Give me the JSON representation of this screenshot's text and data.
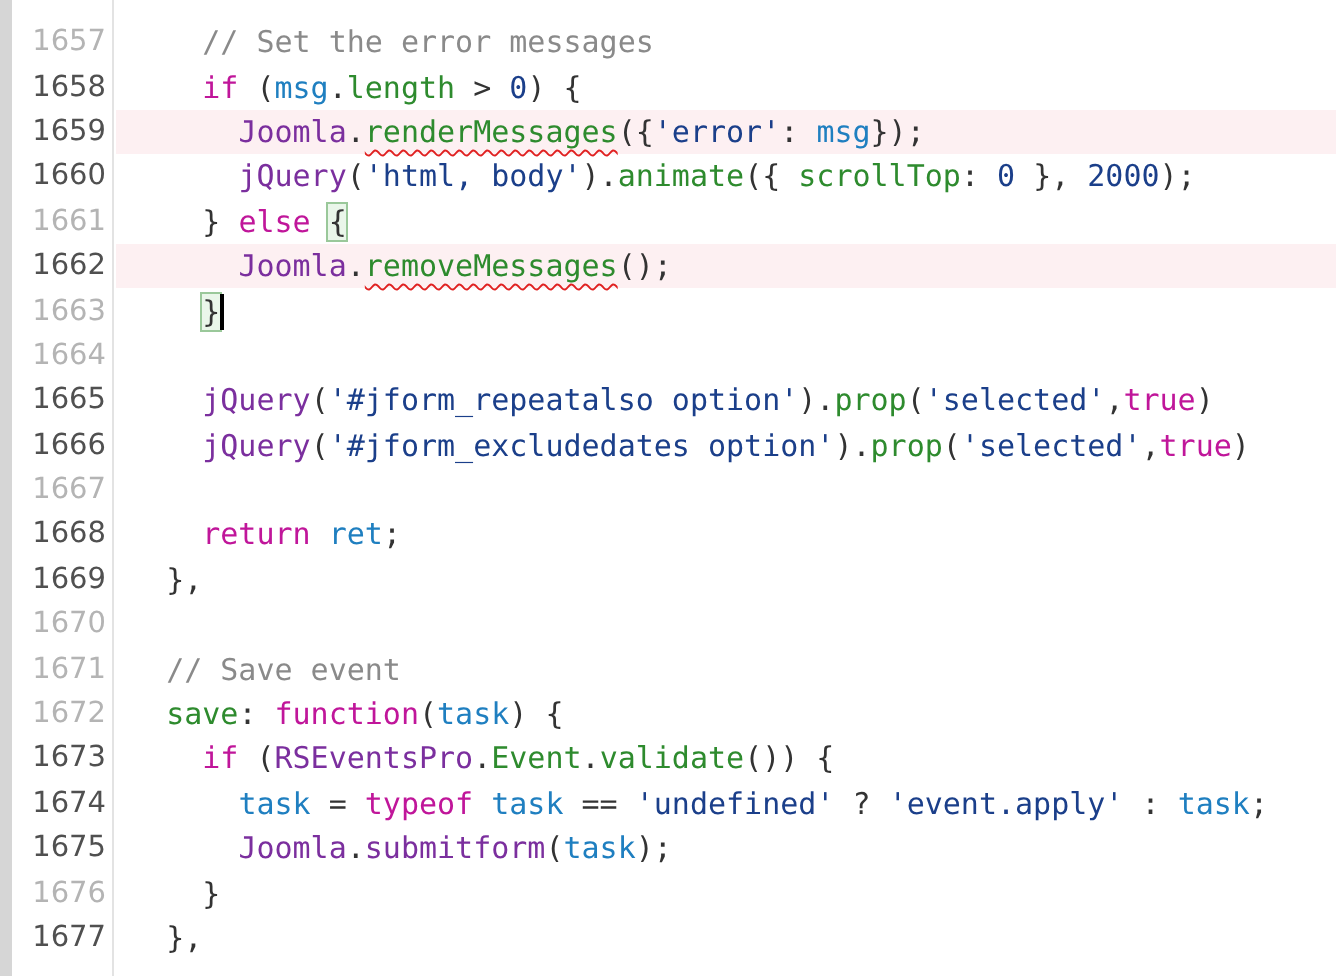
{
  "editor": {
    "lines": [
      {
        "number": "1657",
        "dimmed": true,
        "highlighted": false,
        "cursor": false,
        "tokens": [
          {
            "text": "    // Set the error messages",
            "kind": "comment"
          }
        ]
      },
      {
        "number": "1658",
        "dimmed": false,
        "highlighted": false,
        "cursor": false,
        "tokens": [
          {
            "text": "    if",
            "kind": "keyword"
          },
          {
            "text": " (",
            "kind": "punct"
          },
          {
            "text": "msg",
            "kind": "variable"
          },
          {
            "text": ".",
            "kind": "punct"
          },
          {
            "text": "length",
            "kind": "property"
          },
          {
            "text": " > ",
            "kind": "punct"
          },
          {
            "text": "0",
            "kind": "number"
          },
          {
            "text": ") {",
            "kind": "punct"
          }
        ]
      },
      {
        "number": "1659",
        "dimmed": false,
        "highlighted": true,
        "cursor": false,
        "tokens": [
          {
            "text": "      Joomla",
            "kind": "object"
          },
          {
            "text": ".",
            "kind": "punct"
          },
          {
            "text": "renderMessages",
            "kind": "property",
            "error": true
          },
          {
            "text": "({",
            "kind": "punct"
          },
          {
            "text": "'error'",
            "kind": "string"
          },
          {
            "text": ": ",
            "kind": "punct"
          },
          {
            "text": "msg",
            "kind": "variable"
          },
          {
            "text": "});",
            "kind": "punct"
          }
        ]
      },
      {
        "number": "1660",
        "dimmed": false,
        "highlighted": false,
        "cursor": false,
        "tokens": [
          {
            "text": "      jQuery",
            "kind": "object"
          },
          {
            "text": "(",
            "kind": "punct"
          },
          {
            "text": "'html, body'",
            "kind": "string"
          },
          {
            "text": ").",
            "kind": "punct"
          },
          {
            "text": "animate",
            "kind": "property"
          },
          {
            "text": "({ ",
            "kind": "punct"
          },
          {
            "text": "scrollTop",
            "kind": "property"
          },
          {
            "text": ": ",
            "kind": "punct"
          },
          {
            "text": "0",
            "kind": "number"
          },
          {
            "text": " }, ",
            "kind": "punct"
          },
          {
            "text": "2000",
            "kind": "number"
          },
          {
            "text": ");",
            "kind": "punct"
          }
        ]
      },
      {
        "number": "1661",
        "dimmed": true,
        "highlighted": false,
        "cursor": false,
        "tokens": [
          {
            "text": "    } ",
            "kind": "punct"
          },
          {
            "text": "else ",
            "kind": "keyword"
          },
          {
            "text": "{",
            "kind": "punct",
            "matched": true
          }
        ]
      },
      {
        "number": "1662",
        "dimmed": false,
        "highlighted": true,
        "cursor": false,
        "tokens": [
          {
            "text": "      Joomla",
            "kind": "object"
          },
          {
            "text": ".",
            "kind": "punct"
          },
          {
            "text": "removeMessages",
            "kind": "property",
            "error": true
          },
          {
            "text": "();",
            "kind": "punct"
          }
        ]
      },
      {
        "number": "1663",
        "dimmed": true,
        "highlighted": false,
        "cursor": true,
        "tokens": [
          {
            "text": "    }",
            "kind": "punct",
            "matched": true
          }
        ]
      },
      {
        "number": "1664",
        "dimmed": true,
        "highlighted": false,
        "cursor": false
      },
      {
        "number": "1665",
        "dimmed": false,
        "highlighted": false,
        "cursor": false,
        "tokens": [
          {
            "text": "    jQuery",
            "kind": "object"
          },
          {
            "text": "(",
            "kind": "punct"
          },
          {
            "text": "'#jform_repeatalso option'",
            "kind": "string"
          },
          {
            "text": ").",
            "kind": "punct"
          },
          {
            "text": "prop",
            "kind": "property"
          },
          {
            "text": "(",
            "kind": "punct"
          },
          {
            "text": "'selected'",
            "kind": "string"
          },
          {
            "text": ",",
            "kind": "punct"
          },
          {
            "text": "true",
            "kind": "keyword"
          },
          {
            "text": ")",
            "kind": "punct"
          }
        ]
      },
      {
        "number": "1666",
        "dimmed": false,
        "highlighted": false,
        "cursor": false,
        "tokens": [
          {
            "text": "    jQuery",
            "kind": "object"
          },
          {
            "text": "(",
            "kind": "punct"
          },
          {
            "text": "'#jform_excludedates option'",
            "kind": "string"
          },
          {
            "text": ").",
            "kind": "punct"
          },
          {
            "text": "prop",
            "kind": "property"
          },
          {
            "text": "(",
            "kind": "punct"
          },
          {
            "text": "'selected'",
            "kind": "string"
          },
          {
            "text": ",",
            "kind": "punct"
          },
          {
            "text": "true",
            "kind": "keyword"
          },
          {
            "text": ")",
            "kind": "punct"
          }
        ]
      },
      {
        "number": "1667",
        "dimmed": true,
        "highlighted": false,
        "cursor": false
      },
      {
        "number": "1668",
        "dimmed": false,
        "highlighted": false,
        "cursor": false,
        "tokens": [
          {
            "text": "    return ",
            "kind": "keyword"
          },
          {
            "text": "ret",
            "kind": "variable"
          },
          {
            "text": ";",
            "kind": "punct"
          }
        ]
      },
      {
        "number": "1669",
        "dimmed": false,
        "highlighted": false,
        "cursor": false,
        "tokens": [
          {
            "text": "  },",
            "kind": "punct"
          }
        ]
      },
      {
        "number": "1670",
        "dimmed": true,
        "highlighted": false,
        "cursor": false
      },
      {
        "number": "1671",
        "dimmed": true,
        "highlighted": false,
        "cursor": false,
        "tokens": [
          {
            "text": "  // Save event",
            "kind": "comment"
          }
        ]
      },
      {
        "number": "1672",
        "dimmed": true,
        "highlighted": false,
        "cursor": false,
        "tokens": [
          {
            "text": "  save",
            "kind": "property"
          },
          {
            "text": ": ",
            "kind": "punct"
          },
          {
            "text": "function",
            "kind": "keyword"
          },
          {
            "text": "(",
            "kind": "punct"
          },
          {
            "text": "task",
            "kind": "variable"
          },
          {
            "text": ") {",
            "kind": "punct"
          }
        ]
      },
      {
        "number": "1673",
        "dimmed": false,
        "highlighted": false,
        "cursor": false,
        "tokens": [
          {
            "text": "    if",
            "kind": "keyword"
          },
          {
            "text": " (",
            "kind": "punct"
          },
          {
            "text": "RSEventsPro",
            "kind": "object"
          },
          {
            "text": ".",
            "kind": "punct"
          },
          {
            "text": "Event",
            "kind": "property"
          },
          {
            "text": ".",
            "kind": "punct"
          },
          {
            "text": "validate",
            "kind": "property"
          },
          {
            "text": "()) {",
            "kind": "punct"
          }
        ]
      },
      {
        "number": "1674",
        "dimmed": false,
        "highlighted": false,
        "cursor": false,
        "tokens": [
          {
            "text": "      task",
            "kind": "variable"
          },
          {
            "text": " = ",
            "kind": "punct"
          },
          {
            "text": "typeof ",
            "kind": "keyword"
          },
          {
            "text": "task",
            "kind": "variable"
          },
          {
            "text": " == ",
            "kind": "punct"
          },
          {
            "text": "'undefined'",
            "kind": "string"
          },
          {
            "text": " ? ",
            "kind": "punct"
          },
          {
            "text": "'event.apply'",
            "kind": "string"
          },
          {
            "text": " : ",
            "kind": "punct"
          },
          {
            "text": "task",
            "kind": "variable"
          },
          {
            "text": ";",
            "kind": "punct"
          }
        ]
      },
      {
        "number": "1675",
        "dimmed": false,
        "highlighted": false,
        "cursor": false,
        "tokens": [
          {
            "text": "      Joomla",
            "kind": "object"
          },
          {
            "text": ".",
            "kind": "punct"
          },
          {
            "text": "submitform",
            "kind": "object"
          },
          {
            "text": "(",
            "kind": "punct"
          },
          {
            "text": "task",
            "kind": "variable"
          },
          {
            "text": ");",
            "kind": "punct"
          }
        ]
      },
      {
        "number": "1676",
        "dimmed": true,
        "highlighted": false,
        "cursor": false,
        "tokens": [
          {
            "text": "    }",
            "kind": "punct"
          }
        ]
      },
      {
        "number": "1677",
        "dimmed": false,
        "highlighted": false,
        "cursor": false,
        "tokens": [
          {
            "text": "  },",
            "kind": "punct"
          }
        ]
      }
    ]
  }
}
